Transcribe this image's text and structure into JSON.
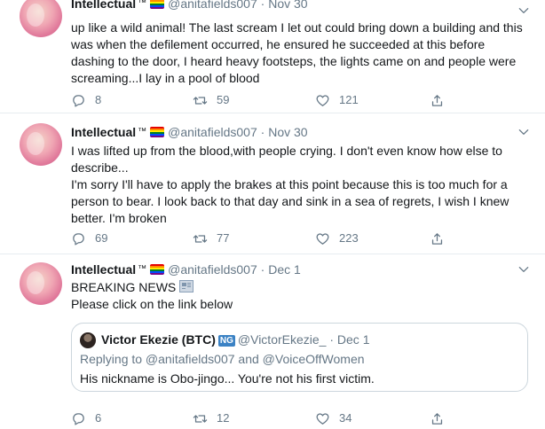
{
  "tweets": [
    {
      "author": "Intellectual",
      "tm": "™",
      "handle": "@anitafields007",
      "separator": "·",
      "date": "Nov 30",
      "text_lines": [
        "up like a wild animal! The last scream I let out could bring down a building and this",
        "was when the defilement occurred, he ensured he succeeded at this before",
        "dashing to the door, I heard heavy footsteps, the lights came on and people were",
        "screaming...I lay in a pool of blood"
      ],
      "replies": "8",
      "retweets": "59",
      "likes": "121"
    },
    {
      "author": "Intellectual",
      "tm": "™",
      "handle": "@anitafields007",
      "separator": "·",
      "date": "Nov 30",
      "text_lines": [
        "I was lifted up from the blood,with people crying. I don't even know how else to",
        "describe...",
        "I'm sorry I'll have to apply the brakes at this point because this is too much for a",
        "person to bear. I look back to that day and sink in a sea of regrets, I wish I knew",
        "better. I'm broken"
      ],
      "replies": "69",
      "retweets": "77",
      "likes": "223"
    },
    {
      "author": "Intellectual",
      "tm": "™",
      "handle": "@anitafields007",
      "separator": "·",
      "date": "Dec 1",
      "text_lines": [
        "BREAKING NEWS",
        "Please click on the link below"
      ],
      "quote": {
        "author": "Victor Ekezie (BTC)",
        "badge": "NG",
        "handle": "@VictorEkezie_",
        "separator": "·",
        "date": "Dec 1",
        "replying_to": "Replying to @anitafields007 and @VoiceOffWomen",
        "text": "His nickname is Obo-jingo... You're not his first victim."
      },
      "replies": "6",
      "retweets": "12",
      "likes": "34"
    }
  ],
  "icons": {
    "reply": "reply-icon",
    "retweet": "retweet-icon",
    "like": "heart-icon",
    "share": "share-icon",
    "caret": "chevron-down-icon",
    "flag": "rainbow-flag-icon",
    "news": "newspaper-icon"
  },
  "colors": {
    "text": "#14171a",
    "secondary": "#657786",
    "divider": "#e6ecf0",
    "quote_border": "#ccd6dd"
  }
}
